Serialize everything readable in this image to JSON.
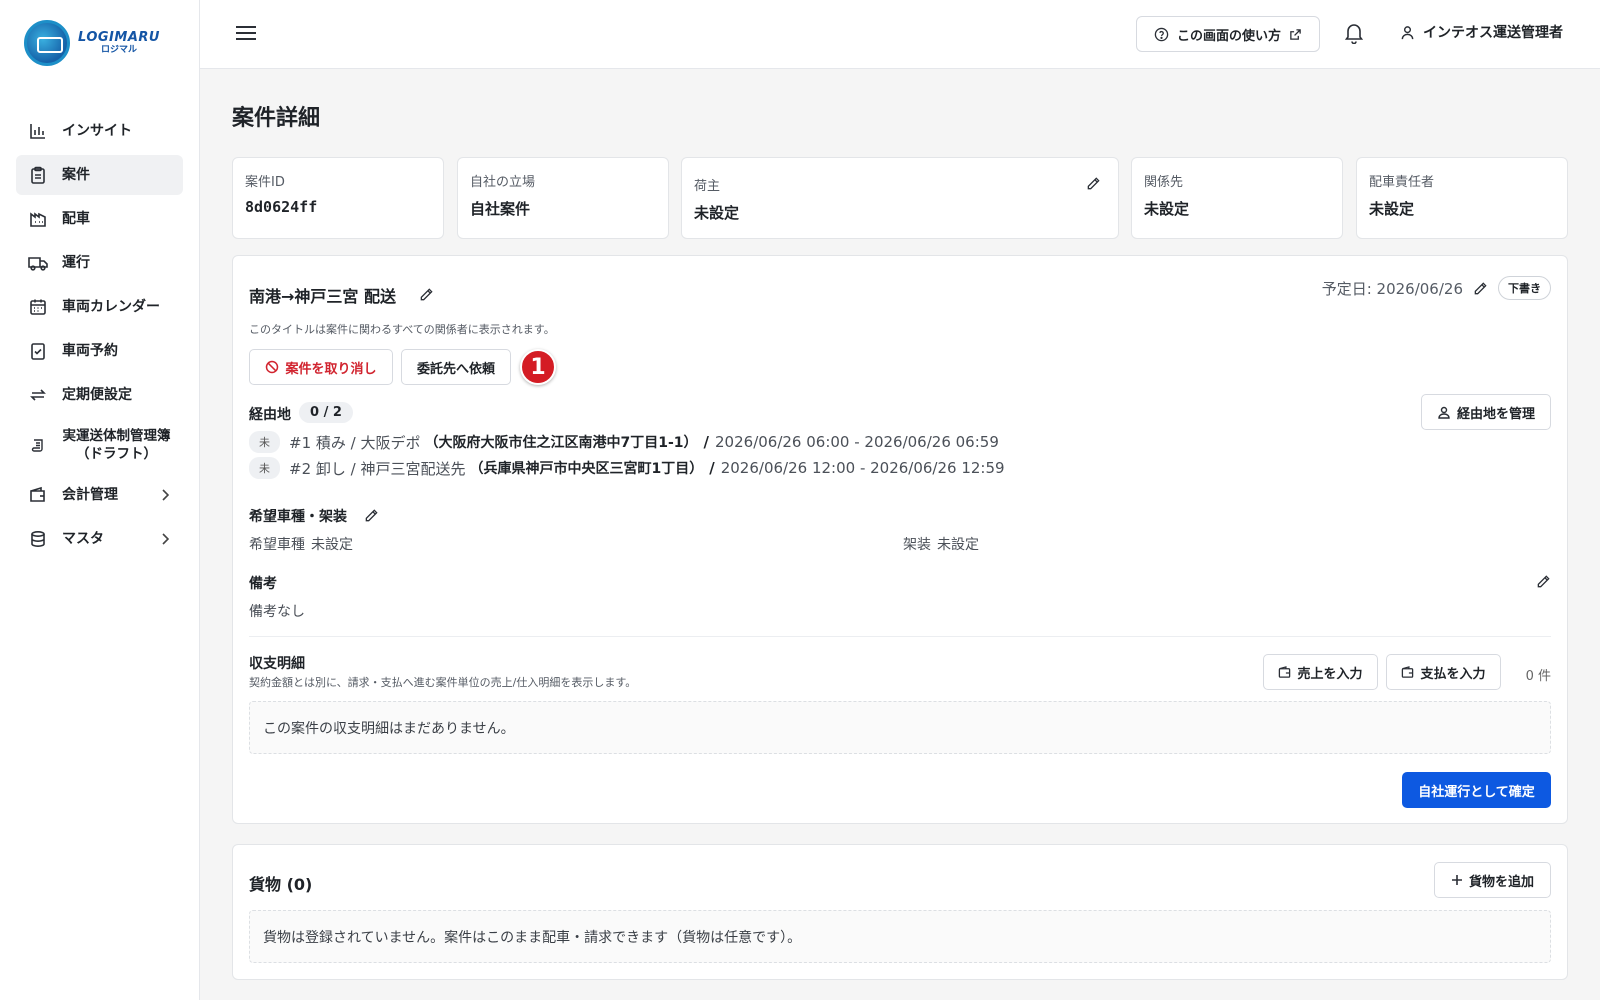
{
  "app": {
    "logo_text": "LOGIMARU",
    "logo_sub": "ロジマル"
  },
  "sidebar": {
    "items": [
      {
        "label": "インサイト",
        "icon": "bar-chart-icon"
      },
      {
        "label": "案件",
        "icon": "clipboard-icon"
      },
      {
        "label": "配車",
        "icon": "factory-icon"
      },
      {
        "label": "運行",
        "icon": "truck-icon"
      },
      {
        "label": "車両カレンダー",
        "icon": "calendar-icon"
      },
      {
        "label": "車両予約",
        "icon": "clipboard-check-icon"
      },
      {
        "label": "定期便設定",
        "icon": "repeat-icon"
      },
      {
        "label": "実運送体制管理簿（ドラフト）",
        "icon": "scroll-icon"
      },
      {
        "label": "会計管理",
        "icon": "wallet-icon"
      },
      {
        "label": "マスタ",
        "icon": "database-icon"
      }
    ]
  },
  "header": {
    "help_label": "この画面の使い方",
    "user_label": "インテオス運送管理者"
  },
  "page": {
    "title": "案件詳細"
  },
  "info": {
    "case_id_label": "案件ID",
    "case_id": "8d0624ff",
    "position_label": "自社の立場",
    "position": "自社案件",
    "shipper_label": "荷主",
    "shipper": "未設定",
    "related_label": "関係先",
    "related": "未設定",
    "dispatcher_label": "配車責任者",
    "dispatcher": "未設定"
  },
  "case": {
    "title": "南港→神戸三宮 配送",
    "note": "このタイトルは案件に関わるすべての関係者に表示されます。",
    "date": "予定日: 2026/06/26",
    "status": "下書き",
    "cancel_label": "案件を取り消し",
    "entrust_label": "委託先へ依頼",
    "marker": "1"
  },
  "stops": {
    "label": "経由地",
    "count": "0 / 2",
    "manage_label": "経由地を管理",
    "items": [
      {
        "badge": "未",
        "text": "#1 積み / 大阪デポ",
        "addr": "（大阪府大阪市住之江区南港中7丁目1-1）",
        "sep": "/",
        "time": "2026/06/26 06:00 - 2026/06/26 06:59"
      },
      {
        "badge": "未",
        "text": "#2 卸し / 神戸三宮配送先",
        "addr": "（兵庫県神戸市中央区三宮町1丁目）",
        "sep": "/",
        "time": "2026/06/26 12:00 - 2026/06/26 12:59"
      }
    ]
  },
  "vehicle": {
    "label": "希望車種・架装",
    "type_key": "希望車種",
    "type_value": "未設定",
    "body_key": "架装",
    "body_value": "未設定"
  },
  "remarks": {
    "label": "備考",
    "value": "備考なし"
  },
  "finance": {
    "label": "収支明細",
    "note": "契約金額とは別に、請求・支払へ進む案件単位の売上/仕入明細を表示します。",
    "sales_label": "売上を入力",
    "pay_label": "支払を入力",
    "count": "0 件",
    "empty": "この案件の収支明細はまだありません。",
    "confirm_label": "自社運行として確定"
  },
  "cargo": {
    "title": "貨物 (0)",
    "add_label": "貨物を追加",
    "empty": "貨物は登録されていません。案件はこのまま配車・請求できます（貨物は任意です）。"
  },
  "colors": {
    "primary": "#0d59e1",
    "danger": "#d1242f",
    "marker": "#d41c24"
  }
}
